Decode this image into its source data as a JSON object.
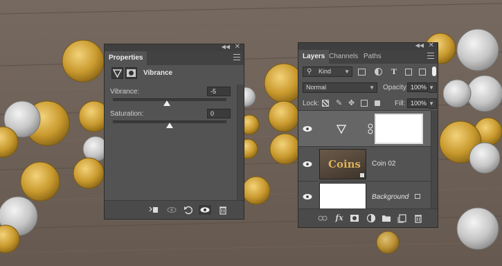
{
  "properties_panel": {
    "tab_title": "Properties",
    "adjustment_name": "Vibrance",
    "vibrance_label": "Vibrance:",
    "vibrance_value": "-5",
    "saturation_label": "Saturation:",
    "saturation_value": "0",
    "vibrance_slider_fraction": 0.475,
    "saturation_slider_fraction": 0.5,
    "icons": [
      "clip-to-layer-icon",
      "view-previous-state-icon",
      "reset-icon",
      "toggle-visibility-icon",
      "trash-icon"
    ]
  },
  "layers_panel": {
    "tabs": [
      "Layers",
      "Channels",
      "Paths"
    ],
    "filter_kind": "Kind",
    "blend_mode": "Normal",
    "opacity_label": "Opacity:",
    "opacity_value": "100%",
    "lock_label": "Lock:",
    "fill_label": "Fill:",
    "fill_value": "100%",
    "layers": [
      {
        "name": "",
        "type": "vibrance-adjustment",
        "visible": true
      },
      {
        "name": "Coin 02",
        "type": "smart-object",
        "visible": true
      },
      {
        "name": "Background",
        "type": "background",
        "visible": true,
        "locked": true
      }
    ],
    "thumbnail_text": "Coins",
    "footer_icons": [
      "link-layers-icon",
      "fx-icon",
      "add-mask-icon",
      "new-adjustment-icon",
      "new-group-icon",
      "new-layer-icon",
      "trash-icon"
    ]
  },
  "colors": {
    "panel_bg": "#535353",
    "panel_dark": "#424242",
    "wood": "#6e625a"
  }
}
